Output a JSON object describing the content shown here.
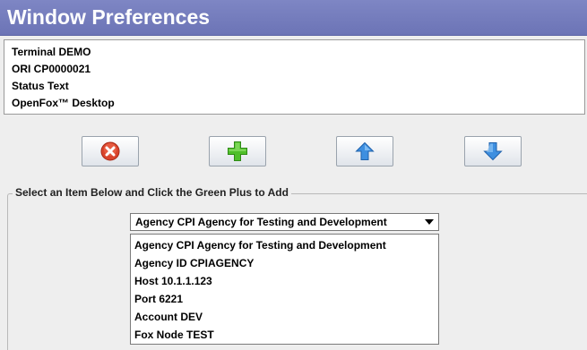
{
  "window": {
    "title": "Window Preferences"
  },
  "info": {
    "items": [
      "Terminal DEMO",
      "ORI CP0000021",
      "Status Text",
      "OpenFox™ Desktop"
    ]
  },
  "toolbar": {
    "buttons": [
      {
        "icon": "remove-icon",
        "color": "#d9442c"
      },
      {
        "icon": "add-icon",
        "color": "#4fbf2a"
      },
      {
        "icon": "move-up-icon",
        "color": "#3e8fe0"
      },
      {
        "icon": "move-down-icon",
        "color": "#3e8fe0"
      }
    ]
  },
  "group": {
    "legend": "Select an Item Below and Click the Green Plus to Add",
    "selected": "Agency CPI Agency for Testing and Development",
    "options": [
      "Agency CPI Agency for Testing and Development",
      "Agency ID CPIAGENCY",
      "Host 10.1.1.123",
      "Port 6221",
      "Account DEV",
      "Fox Node TEST"
    ]
  },
  "colors": {
    "title_bar": "#6c74b6",
    "background": "#eeeeee"
  }
}
